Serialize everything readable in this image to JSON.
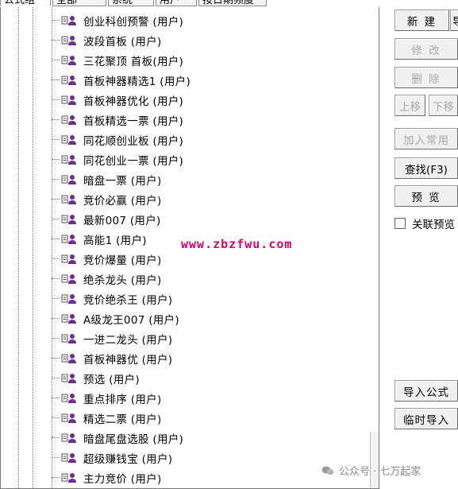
{
  "tabs": [
    {
      "label": "公式组",
      "active": true
    },
    {
      "label": "全部",
      "active": false
    },
    {
      "label": "系统",
      "active": false
    },
    {
      "label": "用户",
      "active": false
    },
    {
      "label": "按日期频度",
      "active": false
    }
  ],
  "tree_items": [
    "创业科创预警  (用户)",
    "波段首板  (用户)",
    "三花聚顶  首板(用户)",
    "首板神器精选1  (用户)",
    "首板神器优化  (用户)",
    "首板精选一票  (用户)",
    "同花顺创业板  (用户)",
    "同花创业一票  (用户)",
    "暗盘一票  (用户)",
    "竞价必赢  (用户)",
    "最新007  (用户)",
    "高能1  (用户)",
    "竞价爆量  (用户)",
    "绝杀龙头  (用户)",
    "竞价绝杀王  (用户)",
    "A级龙王007  (用户)",
    "一进二龙头  (用户)",
    "首板神器优  (用户)",
    "预选  (用户)",
    "重点排序  (用户)",
    "精选二票  (用户)",
    "暗盘尾盘选股  (用户)",
    "超级赚钱宝  (用户)",
    "主力竞价  (用户)"
  ],
  "buttons": {
    "new": "新 建",
    "import_more": "导",
    "modify": "修 改",
    "delete": "删 除",
    "move_up": "上移",
    "move_down": "下移",
    "add_common": "加入常用",
    "find": "查找(F3)",
    "preview": "预 览",
    "import_formula": "导入公式",
    "temp_import": "临时导入"
  },
  "checkbox": {
    "label": "关联预览",
    "checked": false
  },
  "watermark": "www.zbzfwu.com",
  "wechat_caption": "公众号 · 七万起家",
  "icon_names": {
    "formula": "formula-user-icon",
    "wechat": "wechat-icon"
  },
  "colors": {
    "watermark": "#e0006c",
    "icon_purple": "#6f2c91",
    "disabled_text": "#a8a8a8"
  }
}
